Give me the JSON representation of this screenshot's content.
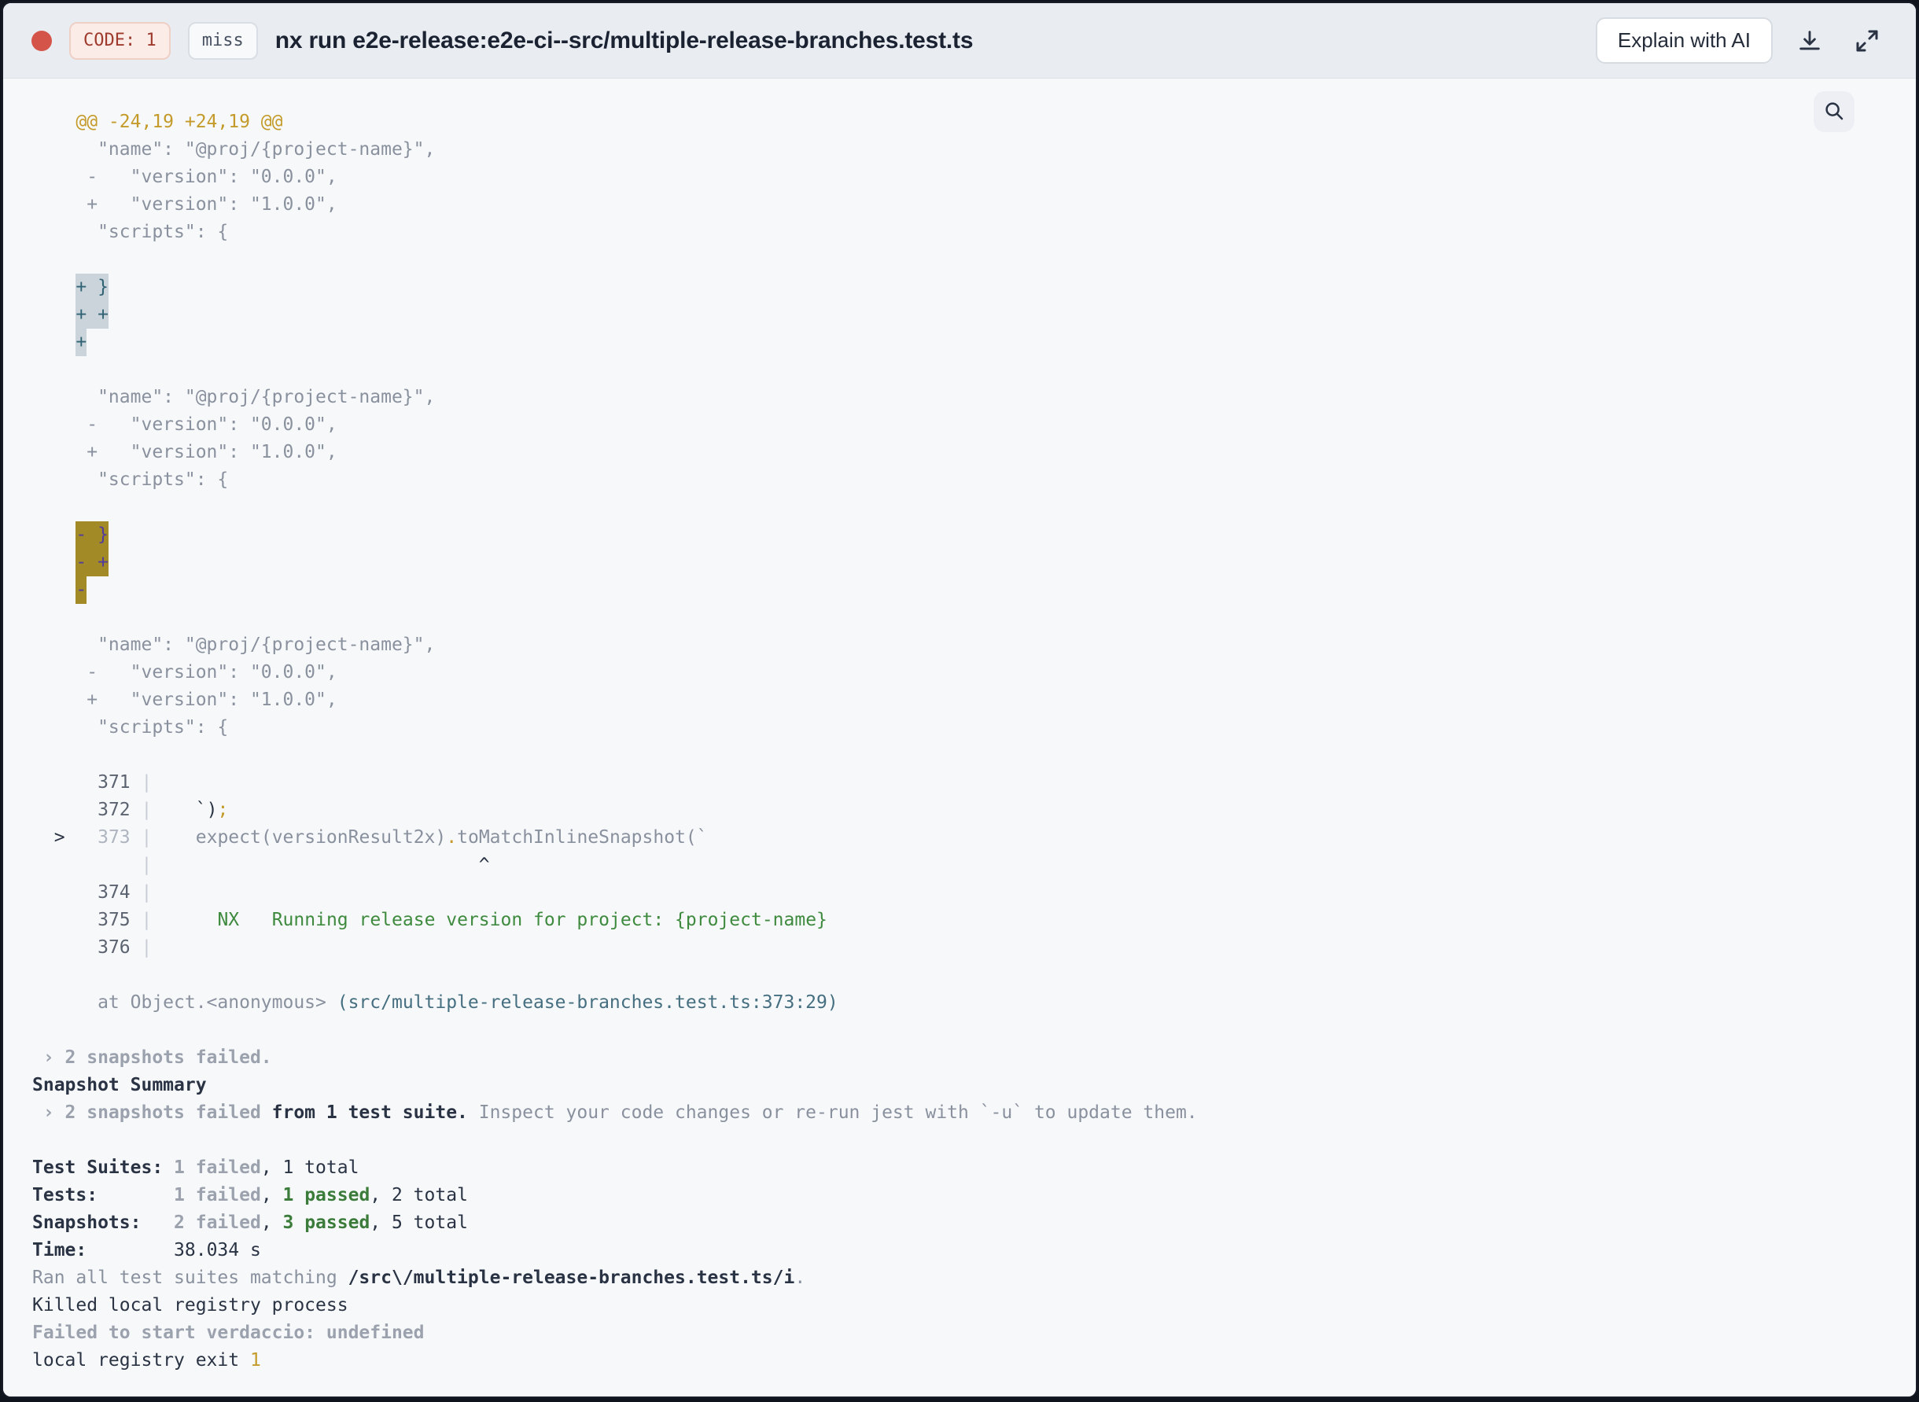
{
  "header": {
    "code_badge": "CODE: 1",
    "cache_badge": "miss",
    "title": "nx run e2e-release:e2e-ci--src/multiple-release-branches.test.ts",
    "explain_button": "Explain with AI"
  },
  "colors": {
    "status_dot": "#d5544a",
    "code_badge_text": "#9e3b2d",
    "diff_hunk_yellow": "#c49b2a",
    "added_highlight_bg": "#ccd4db",
    "added_highlight_text": "#2f6374",
    "removed_highlight_bg": "#a28b26",
    "removed_highlight_text": "#523c9d",
    "passed_green": "#3b7c3b",
    "file_link_teal": "#456f80",
    "header_bg": "#e9edf2",
    "terminal_bg": "#f7f8fa"
  },
  "icons": {
    "status_dot": "red-dot",
    "download": "download-icon",
    "expand": "expand-icon",
    "search": "search-icon"
  },
  "terminal": {
    "lines": [
      {
        "s": [
          {
            "t": "    @@ -24,19 +24,19 @@",
            "c": "yellow"
          }
        ]
      },
      {
        "s": [
          {
            "t": "      \"name\": \"@proj/{project-name}\",",
            "c": "gray"
          }
        ]
      },
      {
        "s": [
          {
            "t": "     -   \"version\": \"0.0.0\",",
            "c": "gray"
          }
        ]
      },
      {
        "s": [
          {
            "t": "     +   \"version\": \"1.0.0\",",
            "c": "gray"
          }
        ]
      },
      {
        "s": [
          {
            "t": "      \"scripts\": {",
            "c": "gray"
          }
        ]
      },
      {
        "s": []
      },
      {
        "s": [
          {
            "t": "    ",
            "c": "gray"
          },
          {
            "t": "+ }",
            "c": "hladd"
          }
        ]
      },
      {
        "s": [
          {
            "t": "    ",
            "c": "gray"
          },
          {
            "t": "+ +",
            "c": "hladd"
          }
        ]
      },
      {
        "s": [
          {
            "t": "    ",
            "c": "gray"
          },
          {
            "t": "+",
            "c": "hladd"
          }
        ]
      },
      {
        "s": []
      },
      {
        "s": [
          {
            "t": "      \"name\": \"@proj/{project-name}\",",
            "c": "gray"
          }
        ]
      },
      {
        "s": [
          {
            "t": "     -   \"version\": \"0.0.0\",",
            "c": "gray"
          }
        ]
      },
      {
        "s": [
          {
            "t": "     +   \"version\": \"1.0.0\",",
            "c": "gray"
          }
        ]
      },
      {
        "s": [
          {
            "t": "      \"scripts\": {",
            "c": "gray"
          }
        ]
      },
      {
        "s": []
      },
      {
        "s": [
          {
            "t": "    ",
            "c": "gray"
          },
          {
            "t": "- }",
            "c": "hldel"
          }
        ]
      },
      {
        "s": [
          {
            "t": "    ",
            "c": "gray"
          },
          {
            "t": "- +",
            "c": "hldel"
          }
        ]
      },
      {
        "s": [
          {
            "t": "    ",
            "c": "gray"
          },
          {
            "t": "-",
            "c": "hldel"
          }
        ]
      },
      {
        "s": []
      },
      {
        "s": [
          {
            "t": "      \"name\": \"@proj/{project-name}\",",
            "c": "gray"
          }
        ]
      },
      {
        "s": [
          {
            "t": "     -   \"version\": \"0.0.0\",",
            "c": "gray"
          }
        ]
      },
      {
        "s": [
          {
            "t": "     +   \"version\": \"1.0.0\",",
            "c": "gray"
          }
        ]
      },
      {
        "s": [
          {
            "t": "      \"scripts\": {",
            "c": "gray"
          }
        ]
      },
      {
        "s": []
      },
      {
        "s": [
          {
            "t": "      ",
            "c": "gray"
          },
          {
            "t": "371",
            "c": "num"
          },
          {
            "t": " ",
            "c": "gray"
          },
          {
            "t": "|",
            "c": "pipe"
          }
        ]
      },
      {
        "s": [
          {
            "t": "      ",
            "c": "gray"
          },
          {
            "t": "372",
            "c": "num"
          },
          {
            "t": " ",
            "c": "gray"
          },
          {
            "t": "|",
            "c": "pipe"
          },
          {
            "t": "    ",
            "c": "gray"
          },
          {
            "t": "`)",
            "c": "dark"
          },
          {
            "t": ";",
            "c": "yellow"
          }
        ]
      },
      {
        "s": [
          {
            "t": "  ",
            "c": "gray"
          },
          {
            "t": ">",
            "c": "dark"
          },
          {
            "t": "   ",
            "c": "gray"
          },
          {
            "t": "373",
            "c": "mutednum"
          },
          {
            "t": " ",
            "c": "gray"
          },
          {
            "t": "|",
            "c": "pipe"
          },
          {
            "t": "    ",
            "c": "gray"
          },
          {
            "t": "expect(versionResult2x)",
            "c": "gray"
          },
          {
            "t": ".",
            "c": "yellow"
          },
          {
            "t": "toMatchInlineSnapshot(`",
            "c": "gray"
          }
        ]
      },
      {
        "s": [
          {
            "t": "          ",
            "c": "gray"
          },
          {
            "t": "|",
            "c": "pipe"
          },
          {
            "t": "                              ",
            "c": "gray"
          },
          {
            "t": "^",
            "c": "dark"
          }
        ]
      },
      {
        "s": [
          {
            "t": "      ",
            "c": "gray"
          },
          {
            "t": "374",
            "c": "num"
          },
          {
            "t": " ",
            "c": "gray"
          },
          {
            "t": "|",
            "c": "pipe"
          }
        ]
      },
      {
        "s": [
          {
            "t": "      ",
            "c": "gray"
          },
          {
            "t": "375",
            "c": "num"
          },
          {
            "t": " ",
            "c": "gray"
          },
          {
            "t": "|",
            "c": "pipe"
          },
          {
            "t": "      ",
            "c": "gray"
          },
          {
            "t": "NX",
            "c": "green"
          },
          {
            "t": "   ",
            "c": "gray"
          },
          {
            "t": "Running release version for project: {project-name}",
            "c": "green"
          }
        ]
      },
      {
        "s": [
          {
            "t": "      ",
            "c": "gray"
          },
          {
            "t": "376",
            "c": "num"
          },
          {
            "t": " ",
            "c": "gray"
          },
          {
            "t": "|",
            "c": "pipe"
          }
        ]
      },
      {
        "s": []
      },
      {
        "s": [
          {
            "t": "      at Object.<anonymous> ",
            "c": "gray"
          },
          {
            "t": "(src/multiple-release-branches.test.ts:373:29)",
            "c": "teal"
          }
        ]
      },
      {
        "s": []
      },
      {
        "s": [
          {
            "t": " › 2 snapshots failed.",
            "c": "graybold"
          }
        ]
      },
      {
        "s": [
          {
            "t": "Snapshot Summary",
            "c": "darkbold"
          }
        ]
      },
      {
        "s": [
          {
            "t": " › 2 snapshots failed ",
            "c": "graybold"
          },
          {
            "t": "from 1 test suite.",
            "c": "darkbold"
          },
          {
            "t": " Inspect your code changes or re-run jest with `-u` to update them.",
            "c": "gray"
          }
        ]
      },
      {
        "s": []
      },
      {
        "s": [
          {
            "t": "Test Suites: ",
            "c": "darkbold"
          },
          {
            "t": "1 failed",
            "c": "graybold"
          },
          {
            "t": ", 1 total",
            "c": "dark"
          }
        ]
      },
      {
        "s": [
          {
            "t": "Tests:",
            "c": "darkbold"
          },
          {
            "t": "       ",
            "c": "dark"
          },
          {
            "t": "1 failed",
            "c": "graybold"
          },
          {
            "t": ", ",
            "c": "dark"
          },
          {
            "t": "1 passed",
            "c": "greenbold"
          },
          {
            "t": ", 2 total",
            "c": "dark"
          }
        ]
      },
      {
        "s": [
          {
            "t": "Snapshots:",
            "c": "darkbold"
          },
          {
            "t": "   ",
            "c": "dark"
          },
          {
            "t": "2 failed",
            "c": "graybold"
          },
          {
            "t": ", ",
            "c": "dark"
          },
          {
            "t": "3 passed",
            "c": "greenbold"
          },
          {
            "t": ", 5 total",
            "c": "dark"
          }
        ]
      },
      {
        "s": [
          {
            "t": "Time:",
            "c": "darkbold"
          },
          {
            "t": "        38.034 s",
            "c": "dark"
          }
        ]
      },
      {
        "s": [
          {
            "t": "Ran all test suites matching ",
            "c": "gray"
          },
          {
            "t": "/src\\/multiple-release-branches.test.ts/i",
            "c": "darkbold"
          },
          {
            "t": ".",
            "c": "gray"
          }
        ]
      },
      {
        "s": [
          {
            "t": "Killed local registry process",
            "c": "dark"
          }
        ]
      },
      {
        "s": [
          {
            "t": "Failed to start verdaccio: undefined",
            "c": "graybold"
          }
        ]
      },
      {
        "s": [
          {
            "t": "local registry exit ",
            "c": "dark"
          },
          {
            "t": "1",
            "c": "yellow"
          }
        ]
      }
    ]
  }
}
